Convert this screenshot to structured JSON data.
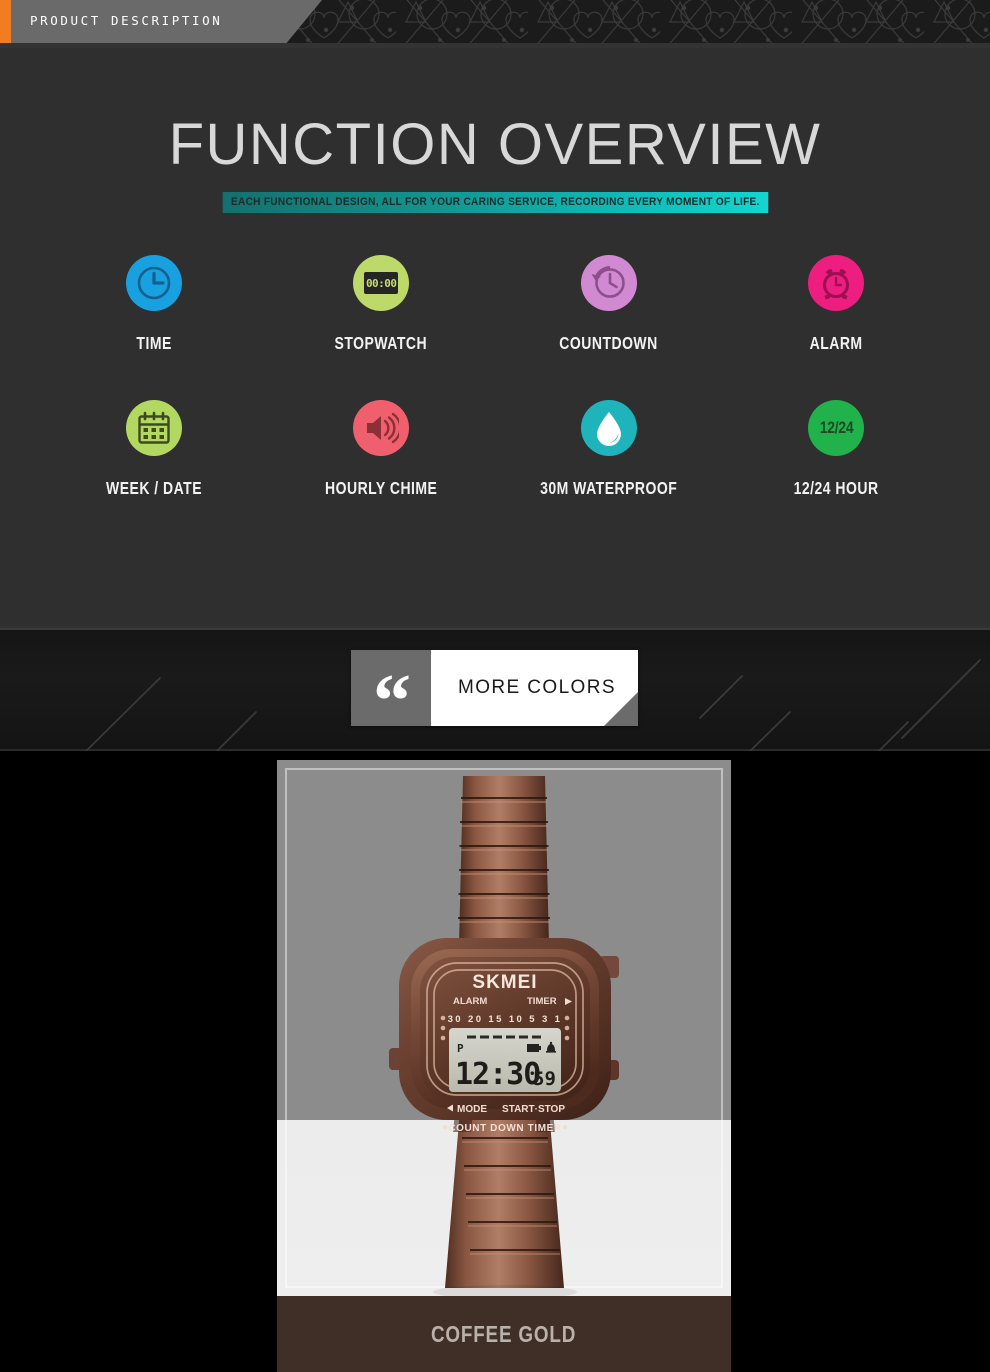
{
  "topbar": {
    "tab_label": "PRODUCT DESCRIPTION",
    "accent_color": "#f07d20",
    "tab_color": "#6a6a6a"
  },
  "function_section": {
    "title": "FUNCTION OVERVIEW",
    "subtitle": "EACH FUNCTIONAL DESIGN, ALL FOR YOUR CARING SERVICE, RECORDING EVERY MOMENT OF LIFE.",
    "background_color": "#2f2f2f",
    "subtitle_gradient_from": "#13706e",
    "subtitle_gradient_to": "#13d6d0",
    "features": [
      {
        "label": "TIME",
        "icon": "clock-icon",
        "circle_color": "#18a0e0",
        "glyph_color": "#12628c"
      },
      {
        "label": "STOPWATCH",
        "icon": "digital-timer-icon",
        "circle_color": "#bcd96a",
        "glyph_color": "#252525",
        "display_value": "00:00"
      },
      {
        "label": "COUNTDOWN",
        "icon": "countdown-clock-icon",
        "circle_color": "#d18ad1",
        "glyph_color": "#8c4f8c"
      },
      {
        "label": "ALARM",
        "icon": "alarm-clock-icon",
        "circle_color": "#ee1d80",
        "glyph_color": "#9c0f52"
      },
      {
        "label": "WEEK / DATE",
        "icon": "calendar-icon",
        "circle_color": "#b2d862",
        "glyph_color": "#3c4a1e"
      },
      {
        "label": "HOURLY CHIME",
        "icon": "speaker-icon",
        "circle_color": "#ef5f6e",
        "glyph_color": "#8c2f38"
      },
      {
        "label": "30M WATERPROOF",
        "icon": "water-drop-icon",
        "circle_color": "#1fb4bc",
        "glyph_color": "#ffffff"
      },
      {
        "label": "12/24 HOUR",
        "icon": "twelve-24-icon",
        "circle_color": "#22b24c",
        "glyph_color": "#1d4a22",
        "display_value": "12/24"
      }
    ]
  },
  "divider_band": {
    "more_colors_label": "MORE COLORS",
    "quote_glyph": "“",
    "quote_block_color": "#6b6b6b"
  },
  "product": {
    "color_name": "COFFEE GOLD",
    "color_bar_color": "#3f2f27",
    "watch": {
      "brand": "SKMEI",
      "left_top_label": "ALARM",
      "right_top_label": "TIMER",
      "scale_marks": "30 20 15 10 5 3 1",
      "lcd_time": "12:30",
      "lcd_seconds": "59",
      "lcd_meridiem": "P",
      "left_bottom_label": "MODE",
      "right_bottom_label": "START·STOP",
      "footer_label": "COUNT DOWN TIMER",
      "case_color": "#6f4436",
      "band_color": "#8a5240"
    }
  }
}
